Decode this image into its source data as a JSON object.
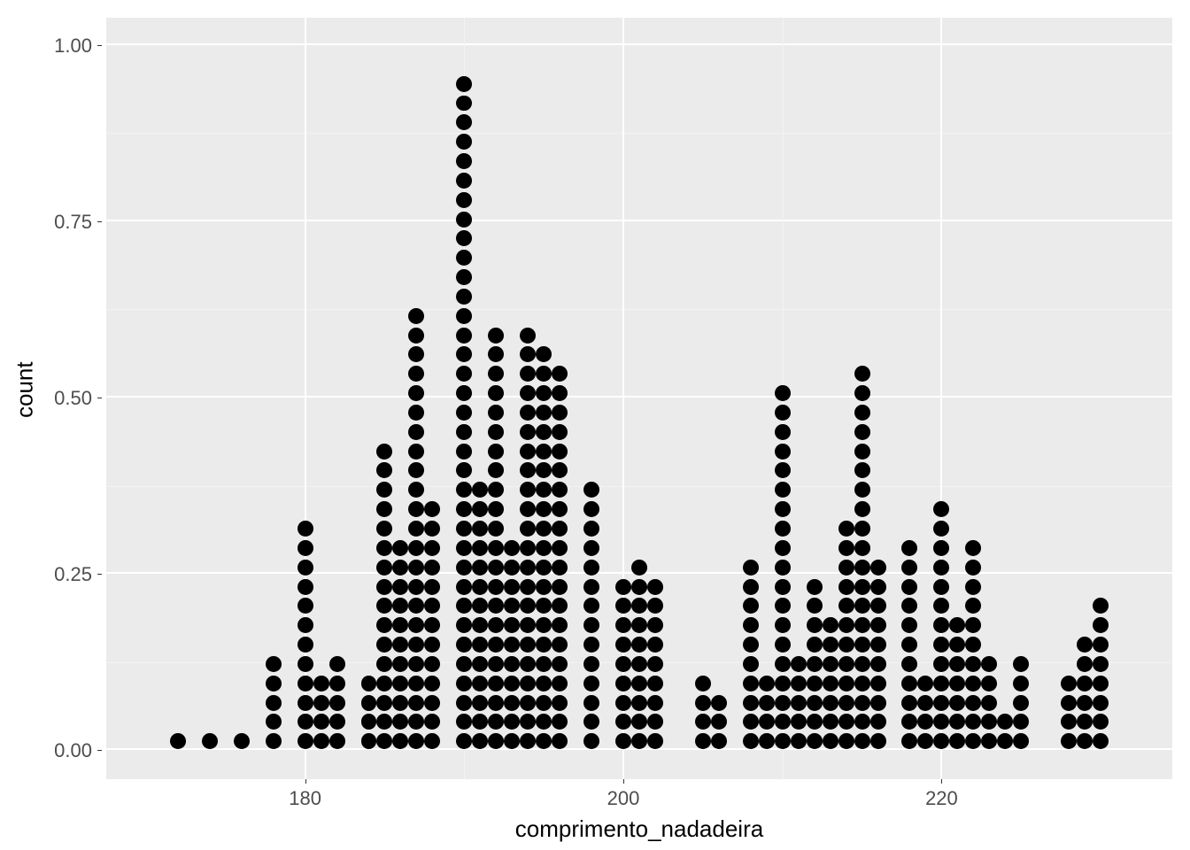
{
  "chart_data": {
    "type": "dotplot",
    "xlabel": "comprimento_nadadeira",
    "ylabel": "count",
    "ylim": [
      0.0,
      1.0
    ],
    "xlim": [
      170,
      232
    ],
    "x_ticks": [
      180,
      200,
      220
    ],
    "y_ticks": [
      0.0,
      0.25,
      0.5,
      0.75,
      1.0
    ],
    "y_tick_labels": [
      "0.00",
      "0.25",
      "0.50",
      "0.75",
      "1.00"
    ],
    "bins": [
      {
        "x": 172,
        "count": 1
      },
      {
        "x": 174,
        "count": 1
      },
      {
        "x": 176,
        "count": 1
      },
      {
        "x": 178,
        "count": 5
      },
      {
        "x": 180,
        "count": 12
      },
      {
        "x": 181,
        "count": 4
      },
      {
        "x": 182,
        "count": 5
      },
      {
        "x": 184,
        "count": 4
      },
      {
        "x": 185,
        "count": 16
      },
      {
        "x": 186,
        "count": 11
      },
      {
        "x": 187,
        "count": 23
      },
      {
        "x": 188,
        "count": 13
      },
      {
        "x": 190,
        "count": 35
      },
      {
        "x": 191,
        "count": 14
      },
      {
        "x": 192,
        "count": 22
      },
      {
        "x": 193,
        "count": 11
      },
      {
        "x": 194,
        "count": 22
      },
      {
        "x": 195,
        "count": 21
      },
      {
        "x": 196,
        "count": 20
      },
      {
        "x": 198,
        "count": 14
      },
      {
        "x": 200,
        "count": 9
      },
      {
        "x": 201,
        "count": 10
      },
      {
        "x": 202,
        "count": 9
      },
      {
        "x": 205,
        "count": 4
      },
      {
        "x": 206,
        "count": 3
      },
      {
        "x": 208,
        "count": 10
      },
      {
        "x": 209,
        "count": 4
      },
      {
        "x": 210,
        "count": 19
      },
      {
        "x": 211,
        "count": 5
      },
      {
        "x": 212,
        "count": 9
      },
      {
        "x": 213,
        "count": 7
      },
      {
        "x": 214,
        "count": 12
      },
      {
        "x": 215,
        "count": 20
      },
      {
        "x": 216,
        "count": 10
      },
      {
        "x": 218,
        "count": 11
      },
      {
        "x": 219,
        "count": 4
      },
      {
        "x": 220,
        "count": 13
      },
      {
        "x": 221,
        "count": 7
      },
      {
        "x": 222,
        "count": 11
      },
      {
        "x": 223,
        "count": 5
      },
      {
        "x": 224,
        "count": 2
      },
      {
        "x": 225,
        "count": 5
      },
      {
        "x": 228,
        "count": 4
      },
      {
        "x": 229,
        "count": 6
      },
      {
        "x": 230,
        "count": 8
      }
    ]
  }
}
